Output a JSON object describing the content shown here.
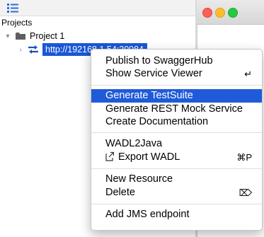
{
  "tree": {
    "header": "Projects",
    "project": {
      "label": "Project 1",
      "expanded": true
    },
    "service": {
      "label": "http://192168.1.54:30984"
    }
  },
  "context_menu": {
    "items": [
      {
        "id": "publish",
        "label": "Publish to SwaggerHub",
        "shortcut": ""
      },
      {
        "id": "service-viewer",
        "label": "Show Service Viewer",
        "shortcut": "↵"
      },
      {
        "id": "gen-testsuite",
        "label": "Generate TestSuite",
        "shortcut": "",
        "selected": true
      },
      {
        "id": "gen-rest-mock",
        "label": "Generate REST Mock Service",
        "shortcut": ""
      },
      {
        "id": "create-doc",
        "label": "Create Documentation",
        "shortcut": ""
      },
      {
        "id": "wadl2java",
        "label": "WADL2Java",
        "shortcut": ""
      },
      {
        "id": "export-wadl",
        "label": "Export WADL",
        "shortcut": "⌘P"
      },
      {
        "id": "new-resource",
        "label": "New Resource",
        "shortcut": ""
      },
      {
        "id": "delete",
        "label": "Delete",
        "shortcut": "⌦"
      },
      {
        "id": "add-jms",
        "label": "Add JMS endpoint",
        "shortcut": ""
      }
    ]
  },
  "colors": {
    "selection": "#1f5bd8",
    "tree_selection": "#1957d6",
    "close": "#fe5f57",
    "minimize": "#febc2e",
    "maximize": "#28c840"
  }
}
